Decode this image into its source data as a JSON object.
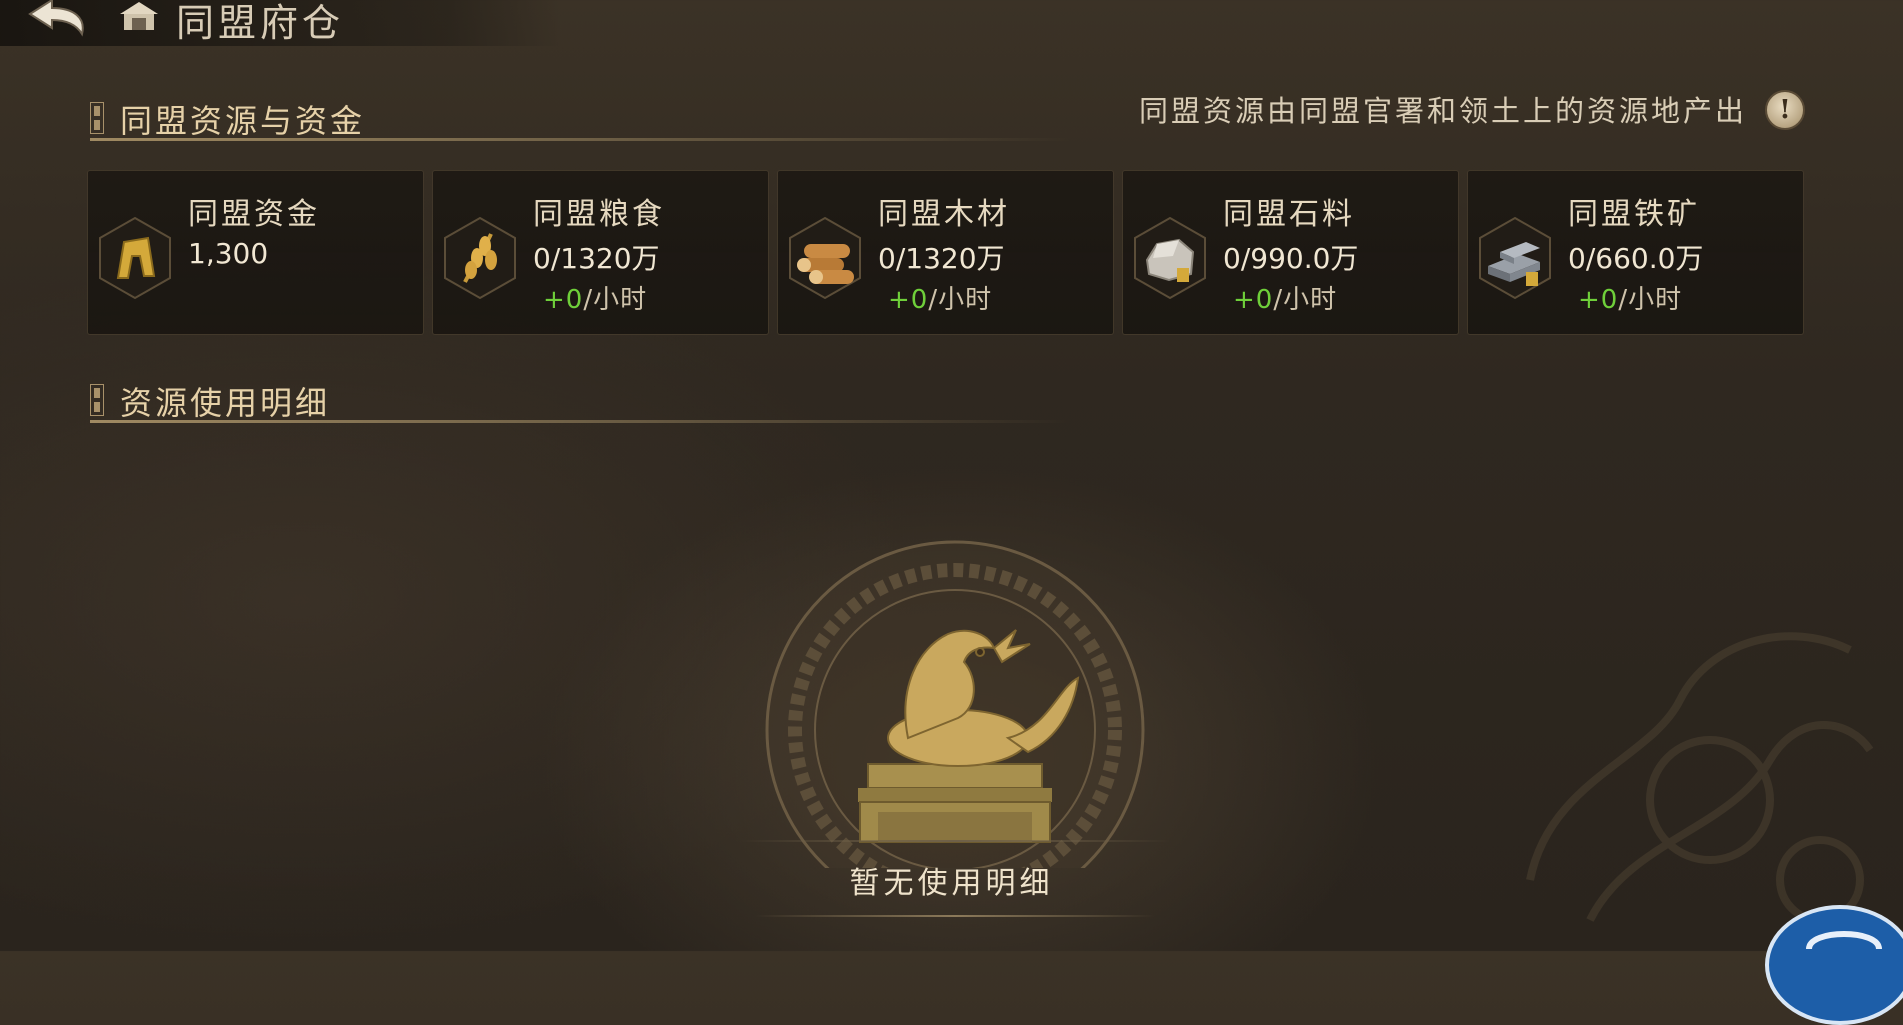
{
  "header": {
    "title": "同盟府仓"
  },
  "resources_section": {
    "title": "同盟资源与资金",
    "info_text": "同盟资源由同盟官署和领土上的资源地产出",
    "info_icon": "!",
    "cards": [
      {
        "name": "同盟资金",
        "amount": "1,300",
        "icon": "coin-icon"
      },
      {
        "name": "同盟粮食",
        "amount": "0/1320万",
        "rate_value": "+0",
        "rate_unit": "/小时",
        "icon": "grain-icon"
      },
      {
        "name": "同盟木材",
        "amount": "0/1320万",
        "rate_value": "+0",
        "rate_unit": "/小时",
        "icon": "wood-icon"
      },
      {
        "name": "同盟石料",
        "amount": "0/990.0万",
        "rate_value": "+0",
        "rate_unit": "/小时",
        "icon": "stone-icon"
      },
      {
        "name": "同盟铁矿",
        "amount": "0/660.0万",
        "rate_value": "+0",
        "rate_unit": "/小时",
        "icon": "iron-icon"
      }
    ]
  },
  "usage_section": {
    "title": "资源使用明细",
    "empty_text": "暂无使用明细"
  },
  "colors": {
    "accent_gold": "#e6d1a8",
    "rate_green": "#6fcf3a",
    "background": "#2f2820"
  }
}
